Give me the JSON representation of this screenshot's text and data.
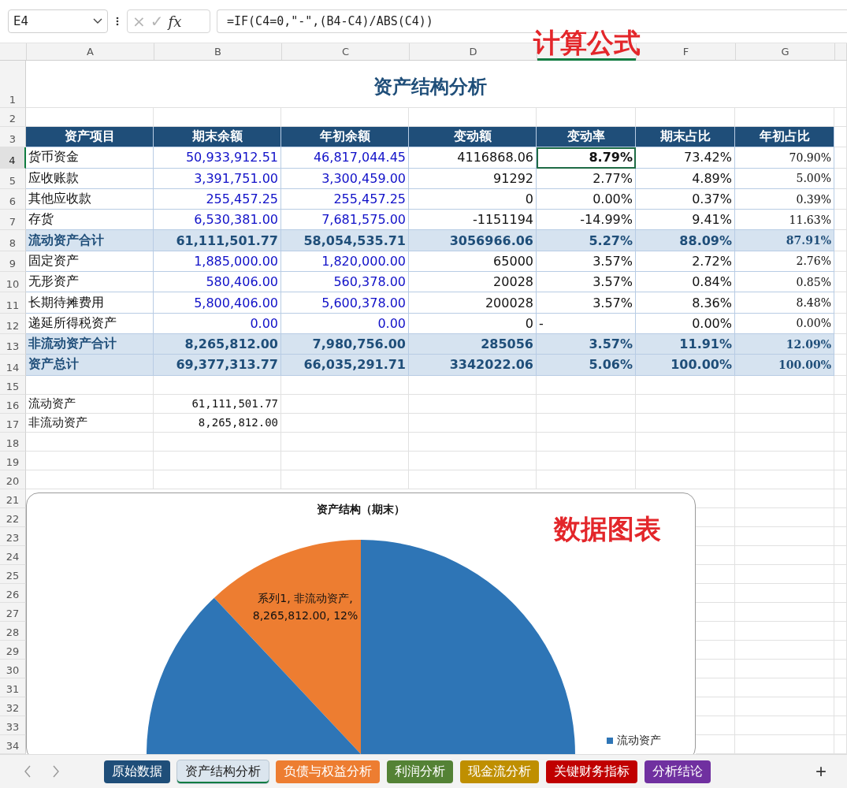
{
  "formula_bar": {
    "name_box": "E4",
    "cancel": "×",
    "confirm": "✓",
    "function": "fx",
    "formula": "=IF(C4=0,\"-\",(B4-C4)/ABS(C4))"
  },
  "annotations": [
    {
      "kind": "formula-note",
      "text": "计算公式"
    },
    {
      "kind": "chart-note",
      "text": "数据图表"
    }
  ],
  "columns": [
    {
      "label": "A",
      "selected": false
    },
    {
      "label": "B",
      "selected": false
    },
    {
      "label": "C",
      "selected": false
    },
    {
      "label": "D",
      "selected": false
    },
    {
      "selected": true
    },
    {
      "label": "F",
      "selected": false
    },
    {
      "label": "G",
      "selected": false
    }
  ],
  "rows": [
    {
      "number": "1",
      "kind": "title",
      "selected": false,
      "cells": {
        "a": "资产结构分析"
      }
    },
    {
      "number": "2",
      "kind": "blank",
      "selected": false,
      "cells": {}
    },
    {
      "number": "3",
      "kind": "header",
      "selected": false,
      "cells": {
        "a": "资产项目",
        "b": "期末余额",
        "c": "年初余额",
        "d": "变动额",
        "e": "变动率",
        "f": "期末占比",
        "g": "年初占比"
      }
    },
    {
      "number": "4",
      "kind": "item",
      "selected": true,
      "cells": {
        "a": "货币资金",
        "b": "50,933,912.51",
        "c": "46,817,044.45",
        "d": "4116868.06",
        "e": "8.79%",
        "f": "73.42%",
        "g": "70.90%"
      }
    },
    {
      "number": "5",
      "kind": "item",
      "selected": false,
      "cells": {
        "a": "应收账款",
        "b": "3,391,751.00",
        "c": "3,300,459.00",
        "d": "91292",
        "e": "2.77%",
        "f": "4.89%",
        "g": "5.00%"
      }
    },
    {
      "number": "6",
      "kind": "item",
      "selected": false,
      "cells": {
        "a": "其他应收款",
        "b": "255,457.25",
        "c": "255,457.25",
        "d": "0",
        "e": "0.00%",
        "f": "0.37%",
        "g": "0.39%"
      }
    },
    {
      "number": "7",
      "kind": "item",
      "selected": false,
      "cells": {
        "a": "存货",
        "b": "6,530,381.00",
        "c": "7,681,575.00",
        "d": "-1151194",
        "e": "-14.99%",
        "f": "9.41%",
        "g": "11.63%"
      }
    },
    {
      "number": "8",
      "kind": "subtotal",
      "selected": false,
      "cells": {
        "a": "流动资产合计",
        "b": "61,111,501.77",
        "c": "58,054,535.71",
        "d": "3056966.06",
        "e": "5.27%",
        "f": "88.09%",
        "g": "87.91%"
      }
    },
    {
      "number": "9",
      "kind": "item",
      "selected": false,
      "cells": {
        "a": "固定资产",
        "b": "1,885,000.00",
        "c": "1,820,000.00",
        "d": "65000",
        "e": "3.57%",
        "f": "2.72%",
        "g": "2.76%"
      }
    },
    {
      "number": "10",
      "kind": "item",
      "selected": false,
      "cells": {
        "a": "无形资产",
        "b": "580,406.00",
        "c": "560,378.00",
        "d": "20028",
        "e": "3.57%",
        "f": "0.84%",
        "g": "0.85%"
      }
    },
    {
      "number": "11",
      "kind": "item",
      "selected": false,
      "cells": {
        "a": "长期待摊费用",
        "b": "5,800,406.00",
        "c": "5,600,378.00",
        "d": "200028",
        "e": "3.57%",
        "f": "8.36%",
        "g": "8.48%"
      }
    },
    {
      "number": "12",
      "kind": "item",
      "selected": false,
      "cells": {
        "a": "递延所得税资产",
        "b": "0.00",
        "c": "0.00",
        "d": "0",
        "e": "-",
        "f": "0.00%",
        "g": "0.00%"
      }
    },
    {
      "number": "13",
      "kind": "subtotal",
      "selected": false,
      "cells": {
        "a": "非流动资产合计",
        "b": "8,265,812.00",
        "c": "7,980,756.00",
        "d": "285056",
        "e": "3.57%",
        "f": "11.91%",
        "g": "12.09%"
      }
    },
    {
      "number": "14",
      "kind": "subtotal",
      "selected": false,
      "cells": {
        "a": "资产总计",
        "b": "69,377,313.77",
        "c": "66,035,291.71",
        "d": "3342022.06",
        "e": "5.06%",
        "f": "100.00%",
        "g": "100.00%"
      }
    },
    {
      "number": "15",
      "kind": "blank",
      "selected": false,
      "cells": {}
    },
    {
      "number": "16",
      "kind": "plain",
      "selected": false,
      "cells": {
        "a": "流动资产",
        "b": "61,111,501.77"
      }
    },
    {
      "number": "17",
      "kind": "plain",
      "selected": false,
      "cells": {
        "a": "非流动资产",
        "b": "8,265,812.00"
      }
    },
    {
      "number": "18",
      "kind": "blank",
      "selected": false,
      "cells": {}
    },
    {
      "number": "19",
      "kind": "blank",
      "selected": false,
      "cells": {}
    },
    {
      "number": "20",
      "kind": "blank",
      "selected": false,
      "cells": {}
    },
    {
      "number": "21",
      "kind": "blank",
      "selected": false,
      "cells": {}
    },
    {
      "number": "22",
      "kind": "blank",
      "selected": false,
      "cells": {}
    },
    {
      "number": "23",
      "kind": "blank",
      "selected": false,
      "cells": {}
    },
    {
      "number": "24",
      "kind": "blank",
      "selected": false,
      "cells": {}
    },
    {
      "number": "25",
      "kind": "blank",
      "selected": false,
      "cells": {}
    },
    {
      "number": "26",
      "kind": "blank",
      "selected": false,
      "cells": {}
    },
    {
      "number": "27",
      "kind": "blank",
      "selected": false,
      "cells": {}
    },
    {
      "number": "28",
      "kind": "blank",
      "selected": false,
      "cells": {}
    },
    {
      "number": "29",
      "kind": "blank",
      "selected": false,
      "cells": {}
    },
    {
      "number": "30",
      "kind": "blank",
      "selected": false,
      "cells": {}
    },
    {
      "number": "31",
      "kind": "blank",
      "selected": false,
      "cells": {}
    },
    {
      "number": "32",
      "kind": "blank",
      "selected": false,
      "cells": {}
    },
    {
      "number": "33",
      "kind": "blank",
      "selected": false,
      "cells": {}
    },
    {
      "number": "34",
      "kind": "blank",
      "selected": false,
      "cells": {}
    }
  ],
  "chart": {
    "chart_data": {
      "type": "pie",
      "title": "资产结构（期末）",
      "series": [
        {
          "values": [
            88,
            12
          ]
        }
      ],
      "annotations": [
        {
          "text": "系列1, 非流动资产, 8,265,812.00, 12%"
        }
      ]
    },
    "legend": [
      {
        "label": "流动资产"
      }
    ]
  },
  "sheet_tabs": [
    {
      "label": "原始数据",
      "selected": false,
      "color": "#1f4e79"
    },
    {
      "label": "资产结构分析",
      "selected": true,
      "color": "#dbe5ee"
    },
    {
      "label": "负债与权益分析",
      "selected": false,
      "color": "#ed7d31"
    },
    {
      "label": "利润分析",
      "selected": false,
      "color": "#548235"
    },
    {
      "label": "现金流分析",
      "selected": false,
      "color": "#bf8f00"
    },
    {
      "label": "关键财务指标",
      "selected": false,
      "color": "#c00000"
    },
    {
      "label": "分析结论",
      "selected": false,
      "color": "#7030a0"
    }
  ],
  "add_sheet": "+"
}
